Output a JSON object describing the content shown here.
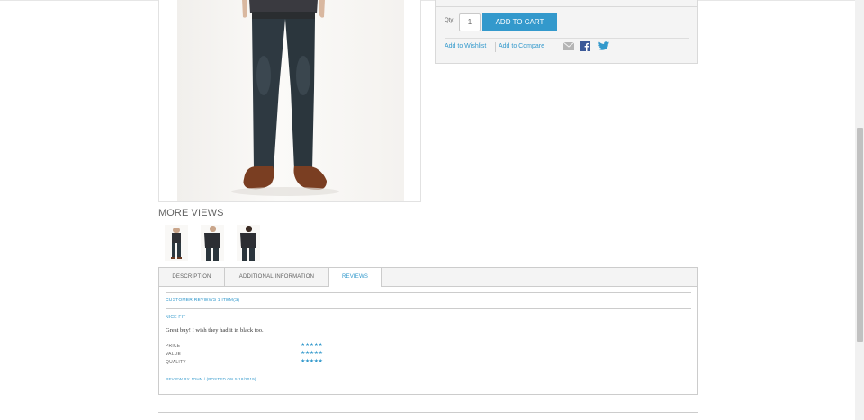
{
  "product": {
    "image_alt": "Product image - man in dark jeans and brown shoes"
  },
  "cart": {
    "qty_label": "Qty:",
    "qty_value": "1",
    "add_to_cart_label": "ADD TO CART",
    "wishlist_label": "Add to Wishlist",
    "compare_label": "Add to Compare",
    "share_icons": [
      "email-icon",
      "facebook-icon",
      "twitter-icon"
    ]
  },
  "more_views": {
    "title": "MORE VIEWS",
    "thumbnail_count": 3
  },
  "tabs": [
    {
      "label": "DESCRIPTION",
      "active": false
    },
    {
      "label": "ADDITIONAL INFORMATION",
      "active": false
    },
    {
      "label": "REVIEWS",
      "active": true
    }
  ],
  "reviews": {
    "heading": "CUSTOMER REVIEWS 1 ITEM(S)",
    "items": [
      {
        "title": "NICE FIT",
        "body": "Great buy! I wish they had it in black too.",
        "ratings": [
          {
            "label": "PRICE",
            "stars": 5
          },
          {
            "label": "VALUE",
            "stars": 5
          },
          {
            "label": "QUALITY",
            "stars": 5
          }
        ],
        "byline": "REVIEW BY JOHN / (POSTED ON 5/18/2019)"
      }
    ]
  },
  "colors": {
    "accent": "#3399cc",
    "text": "#636363",
    "border": "#cccccc",
    "panel_bg": "#f4f4f4"
  }
}
